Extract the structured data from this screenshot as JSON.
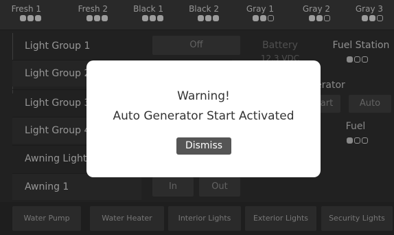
{
  "tanks": [
    {
      "label": "Fresh 1",
      "level": [
        1,
        1,
        1
      ]
    },
    {
      "label": "Fresh 2",
      "level": [
        1,
        1,
        1
      ]
    },
    {
      "label": "Black 1",
      "level": [
        1,
        1,
        1
      ]
    },
    {
      "label": "Black 2",
      "level": [
        1,
        1,
        1
      ]
    },
    {
      "label": "Gray 1",
      "level": [
        1,
        1,
        0
      ]
    },
    {
      "label": "Gray 2",
      "level": [
        1,
        1,
        0
      ]
    },
    {
      "label": "Gray 3",
      "level": [
        1,
        1,
        0
      ]
    }
  ],
  "lights": [
    "Light Group 1",
    "Light Group 2",
    "Light Group 3",
    "Light Group 4",
    "Awning Light",
    "Awning 1"
  ],
  "light_group_1_state": "Off",
  "battery": {
    "label": "Battery",
    "value": "12.3 VDC"
  },
  "fuel_station": {
    "label": "Fuel Station",
    "level": [
      1,
      0,
      0
    ]
  },
  "generator": {
    "label": "erator",
    "start_label": "art",
    "auto_label": "Auto"
  },
  "fuel": {
    "label": "Fuel",
    "level": [
      1,
      0,
      0
    ]
  },
  "awning": {
    "in_label": "In",
    "out_label": "Out"
  },
  "bottom_buttons": [
    "Water Pump",
    "Water Heater",
    "Interior Lights",
    "Exterior Lights",
    "Security Lights"
  ],
  "dialog": {
    "title": "Warning!",
    "message": "Auto Generator Start Activated",
    "dismiss_label": "Dismiss"
  }
}
